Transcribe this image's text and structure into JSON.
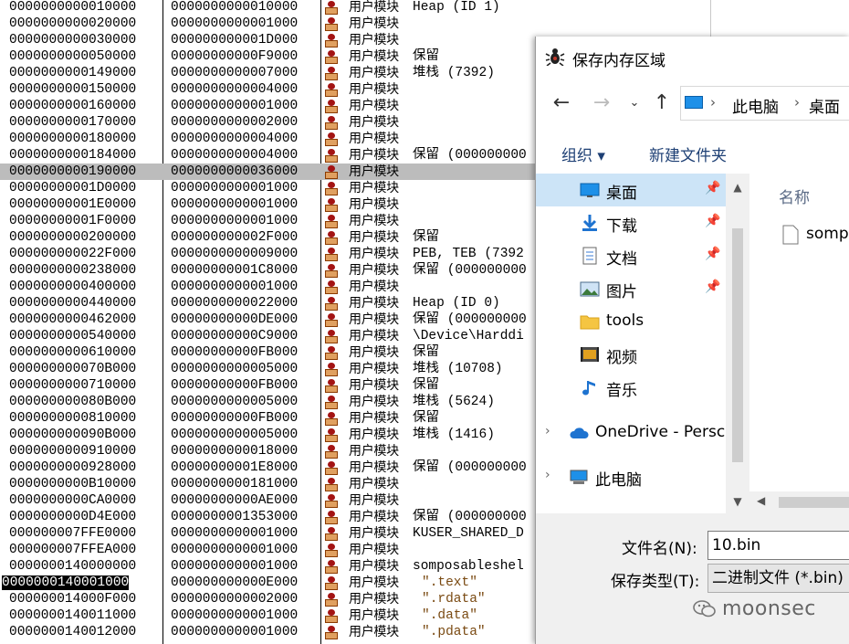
{
  "memory_map": {
    "rows": [
      {
        "addr": "0000000000010000",
        "size": "0000000000010000",
        "type": "用户模块",
        "info": "Heap (ID 1)"
      },
      {
        "addr": "0000000000020000",
        "size": "0000000000001000",
        "type": "用户模块",
        "info": ""
      },
      {
        "addr": "0000000000030000",
        "size": "000000000001D000",
        "type": "用户模块",
        "info": ""
      },
      {
        "addr": "0000000000050000",
        "size": "00000000000F9000",
        "type": "用户模块",
        "info": "保留"
      },
      {
        "addr": "0000000000149000",
        "size": "0000000000007000",
        "type": "用户模块",
        "info": "堆栈 (7392)"
      },
      {
        "addr": "0000000000150000",
        "size": "0000000000004000",
        "type": "用户模块",
        "info": ""
      },
      {
        "addr": "0000000000160000",
        "size": "0000000000001000",
        "type": "用户模块",
        "info": ""
      },
      {
        "addr": "0000000000170000",
        "size": "0000000000002000",
        "type": "用户模块",
        "info": ""
      },
      {
        "addr": "0000000000180000",
        "size": "0000000000004000",
        "type": "用户模块",
        "info": ""
      },
      {
        "addr": "0000000000184000",
        "size": "0000000000004000",
        "type": "用户模块",
        "info": "保留 (000000000"
      },
      {
        "addr": "0000000000190000",
        "size": "0000000000036000",
        "type": "用户模块",
        "info": ""
      },
      {
        "addr": "00000000001D0000",
        "size": "0000000000001000",
        "type": "用户模块",
        "info": ""
      },
      {
        "addr": "00000000001E0000",
        "size": "0000000000001000",
        "type": "用户模块",
        "info": ""
      },
      {
        "addr": "00000000001F0000",
        "size": "0000000000001000",
        "type": "用户模块",
        "info": ""
      },
      {
        "addr": "0000000000200000",
        "size": "000000000002F000",
        "type": "用户模块",
        "info": "保留"
      },
      {
        "addr": "000000000022F000",
        "size": "0000000000009000",
        "type": "用户模块",
        "info": "PEB, TEB (7392"
      },
      {
        "addr": "0000000000238000",
        "size": "00000000001C8000",
        "type": "用户模块",
        "info": "保留 (000000000"
      },
      {
        "addr": "0000000000400000",
        "size": "0000000000001000",
        "type": "用户模块",
        "info": ""
      },
      {
        "addr": "0000000000440000",
        "size": "0000000000022000",
        "type": "用户模块",
        "info": "Heap (ID 0)"
      },
      {
        "addr": "0000000000462000",
        "size": "00000000000DE000",
        "type": "用户模块",
        "info": "保留 (000000000"
      },
      {
        "addr": "0000000000540000",
        "size": "00000000000C9000",
        "type": "用户模块",
        "info": "\\Device\\Harddi"
      },
      {
        "addr": "0000000000610000",
        "size": "00000000000FB000",
        "type": "用户模块",
        "info": "保留"
      },
      {
        "addr": "000000000070B000",
        "size": "0000000000005000",
        "type": "用户模块",
        "info": "堆栈 (10708)"
      },
      {
        "addr": "0000000000710000",
        "size": "00000000000FB000",
        "type": "用户模块",
        "info": "保留"
      },
      {
        "addr": "000000000080B000",
        "size": "0000000000005000",
        "type": "用户模块",
        "info": "堆栈 (5624)"
      },
      {
        "addr": "0000000000810000",
        "size": "00000000000FB000",
        "type": "用户模块",
        "info": "保留"
      },
      {
        "addr": "000000000090B000",
        "size": "0000000000005000",
        "type": "用户模块",
        "info": "堆栈 (1416)"
      },
      {
        "addr": "0000000000910000",
        "size": "0000000000018000",
        "type": "用户模块",
        "info": ""
      },
      {
        "addr": "0000000000928000",
        "size": "00000000001E8000",
        "type": "用户模块",
        "info": "保留 (000000000"
      },
      {
        "addr": "0000000000B10000",
        "size": "0000000000181000",
        "type": "用户模块",
        "info": ""
      },
      {
        "addr": "0000000000CA0000",
        "size": "00000000000AE000",
        "type": "用户模块",
        "info": ""
      },
      {
        "addr": "0000000000D4E000",
        "size": "0000000001353000",
        "type": "用户模块",
        "info": "保留 (000000000"
      },
      {
        "addr": "000000007FFE0000",
        "size": "0000000000001000",
        "type": "用户模块",
        "info": "KUSER_SHARED_D"
      },
      {
        "addr": "000000007FFEA000",
        "size": "0000000000001000",
        "type": "用户模块",
        "info": ""
      },
      {
        "addr": "0000000140000000",
        "size": "0000000000001000",
        "type": "用户模块",
        "info": "somposableshel"
      },
      {
        "addr": "0000000140001000",
        "size": "000000000000E000",
        "type": "用户模块",
        "info": "\".text\""
      },
      {
        "addr": "000000014000F000",
        "size": "0000000000002000",
        "type": "用户模块",
        "info": "\".rdata\""
      },
      {
        "addr": "0000000140011000",
        "size": "0000000000001000",
        "type": "用户模块",
        "info": "\".data\""
      },
      {
        "addr": "0000000140012000",
        "size": "0000000000001000",
        "type": "用户模块",
        "info": "\".pdata\""
      }
    ],
    "selected_row_index": 10,
    "highlighted_addr_index": 35
  },
  "dialog": {
    "title": "保存内存区域",
    "breadcrumb": [
      "此电脑",
      "桌面"
    ],
    "organize_label": "组织 ▾",
    "new_folder_label": "新建文件夹",
    "nav_items": [
      {
        "label": "桌面",
        "icon": "desktop-icon",
        "pinned": true,
        "selected": true
      },
      {
        "label": "下载",
        "icon": "download-icon",
        "pinned": true,
        "selected": false
      },
      {
        "label": "文档",
        "icon": "document-icon",
        "pinned": true,
        "selected": false
      },
      {
        "label": "图片",
        "icon": "pictures-icon",
        "pinned": true,
        "selected": false
      },
      {
        "label": "tools",
        "icon": "folder-icon",
        "pinned": false,
        "selected": false
      },
      {
        "label": "视频",
        "icon": "video-icon",
        "pinned": false,
        "selected": false
      },
      {
        "label": "音乐",
        "icon": "music-icon",
        "pinned": false,
        "selected": false
      }
    ],
    "onedrive_label": "OneDrive - Persc",
    "thispc_label": "此电脑",
    "column_name": "名称",
    "file_item": "somp",
    "filename_label": "文件名(N):",
    "filename_value": "10.bin",
    "filetype_label": "保存类型(T):",
    "filetype_value": "二进制文件 (*.bin)"
  },
  "watermark": "moonsec",
  "colors": {
    "selection": "#cce4f7",
    "row_highlight": "#bcbcbc",
    "link_blue": "#1d3f74"
  }
}
